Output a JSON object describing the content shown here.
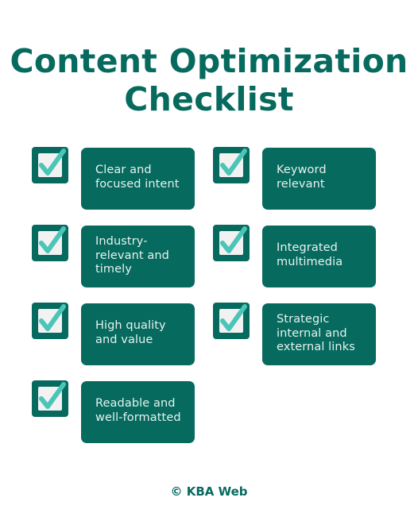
{
  "title": {
    "line1": "Content Optimization",
    "line2": "Checklist"
  },
  "colors": {
    "primary": "#066a5e",
    "check": "#4ac5b8",
    "check_bg": "#f2f2f2",
    "card_text": "#e8f2f0"
  },
  "checklist": {
    "items": [
      {
        "label": "Clear and\nfocused intent",
        "checked": true,
        "icon": "checkmark-icon"
      },
      {
        "label": "Keyword\nrelevant",
        "checked": true,
        "icon": "checkmark-icon"
      },
      {
        "label": "Industry-\nrelevant and\ntimely",
        "checked": true,
        "icon": "checkmark-icon"
      },
      {
        "label": "Integrated\nmultimedia",
        "checked": true,
        "icon": "checkmark-icon"
      },
      {
        "label": "High quality\nand value",
        "checked": true,
        "icon": "checkmark-icon"
      },
      {
        "label": "Strategic\ninternal and\nexternal links",
        "checked": true,
        "icon": "checkmark-icon"
      },
      {
        "label": "Readable and\nwell-formatted",
        "checked": true,
        "icon": "checkmark-icon"
      }
    ]
  },
  "footer": {
    "text": "© KBA Web"
  }
}
